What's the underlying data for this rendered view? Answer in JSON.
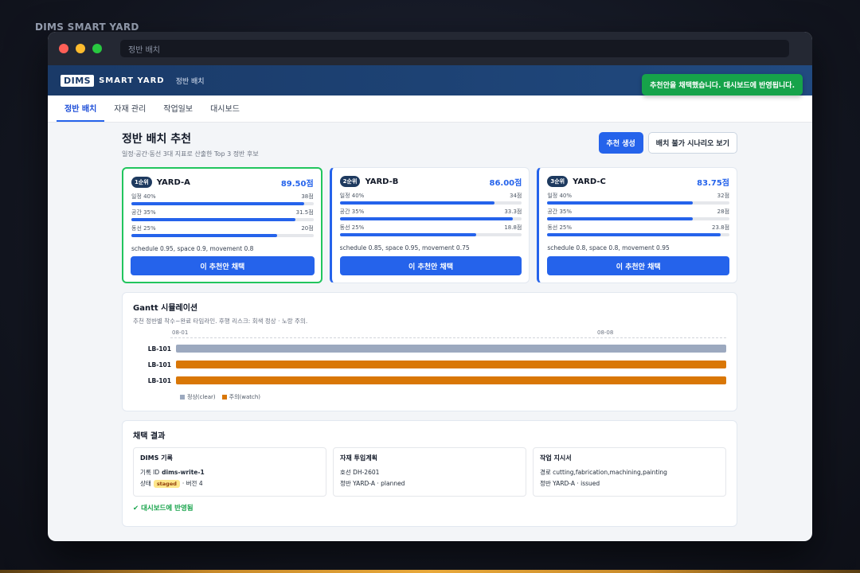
{
  "app_title": "DIMS SMART YARD",
  "browser": {
    "url_text": "정반 배치"
  },
  "header": {
    "logo_box": "DIMS",
    "logo_text": "SMART YARD",
    "page": "정반 배치"
  },
  "toast": "추천안을 채택했습니다. 대시보드에 반영됩니다.",
  "tabs": [
    {
      "label": "정반 배치",
      "active": true
    },
    {
      "label": "자재 관리",
      "active": false
    },
    {
      "label": "작업일보",
      "active": false
    },
    {
      "label": "대시보드",
      "active": false
    }
  ],
  "section": {
    "title": "정반 배치 추천",
    "subtitle": "일정·공간·동선 3대 지표로 산출한 Top 3 정반 후보",
    "primary_button": "추천 생성",
    "secondary_button": "배치 불가 시나리오 보기"
  },
  "cards": [
    {
      "rank": "1순위",
      "yard": "YARD-A",
      "score": "89.50점",
      "metrics": [
        {
          "label": "일정 40%",
          "value": "38점",
          "fraction": 0.95
        },
        {
          "label": "공간 35%",
          "value": "31.5점",
          "fraction": 0.9
        },
        {
          "label": "동선 25%",
          "value": "20점",
          "fraction": 0.8
        }
      ],
      "factors": "schedule 0.95, space 0.9, movement 0.8",
      "button": "이 추천안 채택"
    },
    {
      "rank": "2순위",
      "yard": "YARD-B",
      "score": "86.00점",
      "metrics": [
        {
          "label": "일정 40%",
          "value": "34점",
          "fraction": 0.85
        },
        {
          "label": "공간 35%",
          "value": "33.3점",
          "fraction": 0.95
        },
        {
          "label": "동선 25%",
          "value": "18.8점",
          "fraction": 0.75
        }
      ],
      "factors": "schedule 0.85, space 0.95, movement 0.75",
      "button": "이 추천안 채택"
    },
    {
      "rank": "3순위",
      "yard": "YARD-C",
      "score": "83.75점",
      "metrics": [
        {
          "label": "일정 40%",
          "value": "32점",
          "fraction": 0.8
        },
        {
          "label": "공간 35%",
          "value": "28점",
          "fraction": 0.8
        },
        {
          "label": "동선 25%",
          "value": "23.8점",
          "fraction": 0.95
        }
      ],
      "factors": "schedule 0.8, space 0.8, movement 0.95",
      "button": "이 추천안 채택"
    }
  ],
  "gantt": {
    "title": "Gantt 시뮬레이션",
    "subtitle": "추천 정반별 착수~완료 타임라인. 후행 리스크: 회색 정상 · 노랑 주의.",
    "axis": [
      "08-01",
      "08-08"
    ],
    "rows": [
      {
        "label": "LB-101",
        "status": "clear"
      },
      {
        "label": "LB-101",
        "status": "watch"
      },
      {
        "label": "LB-101",
        "status": "watch"
      }
    ],
    "legend": [
      {
        "label": "정상(clear)",
        "color": "#9ca9bf"
      },
      {
        "label": "주의(watch)",
        "color": "#d97706"
      }
    ]
  },
  "result": {
    "title": "채택 결과",
    "dims": {
      "title": "DIMS 기록",
      "record_label": "기록 ID",
      "record_id": "dims-write-1",
      "status_label": "상태",
      "status": "staged",
      "version": "· 버전 4"
    },
    "material": {
      "title": "자재 투입계획",
      "line1": "호선 DH-2601",
      "line2": "정반 YARD-A · planned"
    },
    "order": {
      "title": "작업 지시서",
      "line1": "경로 cutting,fabrication,machining,painting",
      "line2": "정반 YARD-A · issued"
    },
    "reflected": "대시보드에 반영됨"
  }
}
